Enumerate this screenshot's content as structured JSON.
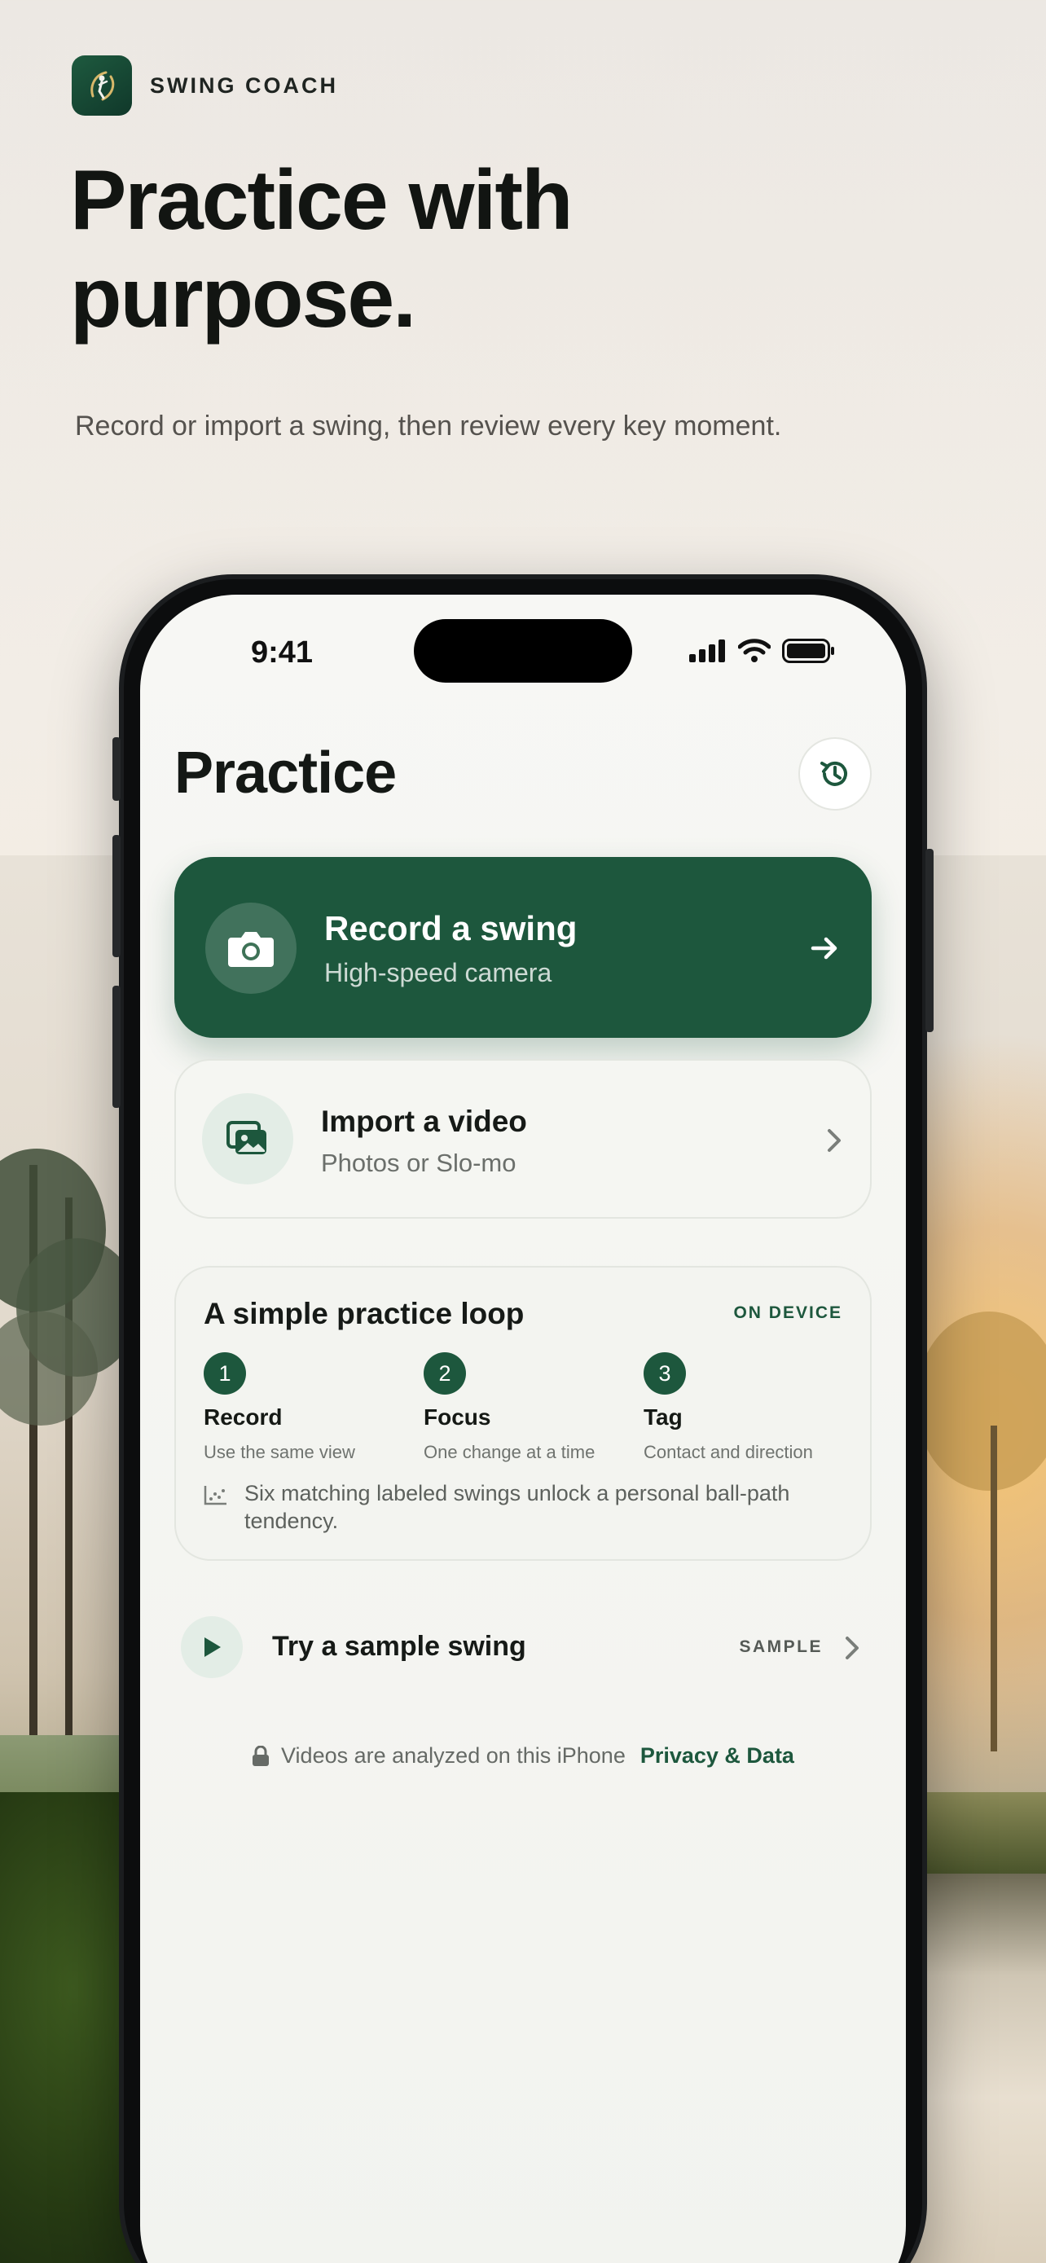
{
  "brand": {
    "name": "SWING COACH",
    "icon": "golf-swing-logo-icon"
  },
  "hero": {
    "title": "Practice with purpose.",
    "subtitle": "Record or import a swing, then review every key moment."
  },
  "status_bar": {
    "time": "9:41",
    "icons": [
      "signal-icon",
      "wifi-icon",
      "battery-icon"
    ]
  },
  "screen": {
    "title": "Practice",
    "history_icon": "history-icon",
    "record": {
      "title": "Record a swing",
      "subtitle": "High-speed camera",
      "icon": "camera-icon"
    },
    "import": {
      "title": "Import a video",
      "subtitle": "Photos or Slo-mo",
      "icon": "photos-icon"
    },
    "loop": {
      "title": "A simple practice loop",
      "badge": "ON DEVICE",
      "steps": [
        {
          "num": "1",
          "label": "Record",
          "desc": "Use the same view"
        },
        {
          "num": "2",
          "label": "Focus",
          "desc": "One change at a time"
        },
        {
          "num": "3",
          "label": "Tag",
          "desc": "Contact and direction"
        }
      ],
      "note": "Six matching labeled swings unlock a personal ball-path tendency."
    },
    "sample": {
      "label": "Try a sample swing",
      "badge": "SAMPLE"
    },
    "privacy": {
      "text": "Videos are analyzed on this iPhone",
      "link": "Privacy & Data"
    }
  },
  "colors": {
    "accent": "#1d573d",
    "accent_light": "#e3ede6"
  }
}
